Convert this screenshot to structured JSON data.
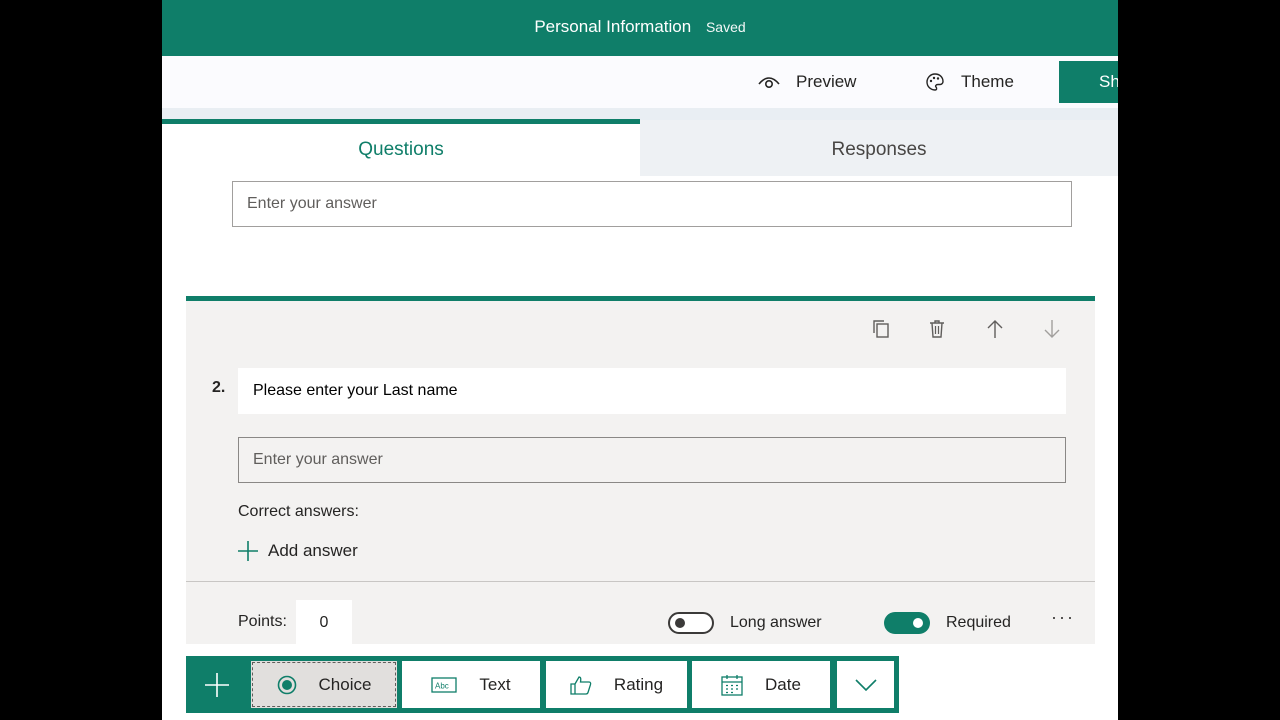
{
  "header": {
    "title": "Personal Information",
    "status": "Saved"
  },
  "toolbar": {
    "preview_label": "Preview",
    "theme_label": "Theme",
    "share_label": "Sh"
  },
  "tabs": [
    {
      "label": "Questions"
    },
    {
      "label": "Responses"
    }
  ],
  "question1": {
    "answer_placeholder": "Enter your answer"
  },
  "question2": {
    "number": "2.",
    "title": "Please enter your Last name",
    "answer_placeholder": "Enter your answer",
    "correct_answers_label": "Correct answers:",
    "add_answer_label": "Add answer",
    "points_label": "Points:",
    "points_value": "0",
    "long_answer_label": "Long answer",
    "long_answer_on": false,
    "required_label": "Required",
    "required_on": true,
    "more_label": "···"
  },
  "insert_bar": {
    "items": [
      {
        "label": "Choice",
        "icon": "radio-icon"
      },
      {
        "label": "Text",
        "icon": "text-abc-icon"
      },
      {
        "label": "Rating",
        "icon": "thumbs-up-icon"
      },
      {
        "label": "Date",
        "icon": "calendar-icon"
      }
    ]
  },
  "colors": {
    "accent": "#0f7e69",
    "card_bg": "#f3f2f1",
    "tab_inactive_bg": "#eef1f4"
  }
}
